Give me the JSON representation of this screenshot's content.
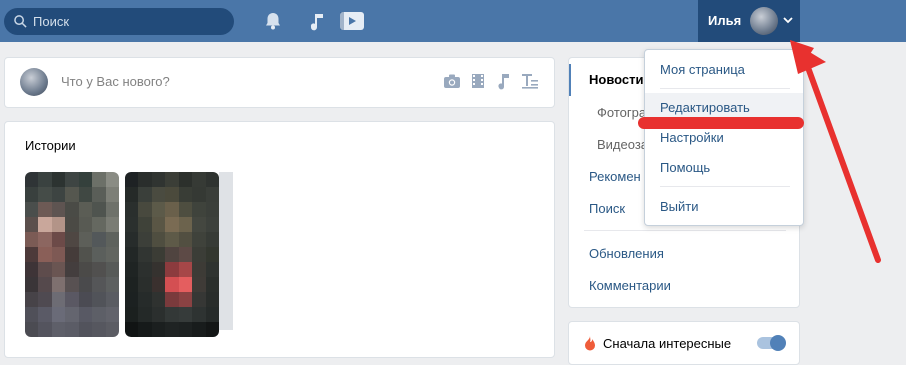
{
  "header": {
    "search_placeholder": "Поиск",
    "user_name": "Илья",
    "icons": [
      "search-icon",
      "bell-icon",
      "music-note-icon",
      "video-play-icon",
      "chevron-down-icon"
    ]
  },
  "post_box": {
    "placeholder": "Что у Вас нового?",
    "icons": [
      "camera-icon",
      "film-icon",
      "music-icon",
      "text-format-icon"
    ]
  },
  "stories": {
    "title": "Истории"
  },
  "right_menu": {
    "items": [
      {
        "label": "Новости",
        "active": true
      },
      {
        "label": "Фотогра",
        "sub": true
      },
      {
        "label": "Видеоза",
        "sub": true
      },
      {
        "label": "Рекомен"
      },
      {
        "label": "Поиск"
      },
      {
        "label": "Обновления"
      },
      {
        "label": "Комментарии"
      }
    ]
  },
  "sort": {
    "label": "Сначала интересные",
    "enabled": true
  },
  "dropdown": {
    "items": [
      {
        "label": "Моя страница"
      },
      {
        "label": "Редактировать",
        "highlighted": true
      },
      {
        "label": "Настройки"
      },
      {
        "label": "Помощь"
      },
      {
        "label": "Выйти"
      }
    ]
  },
  "colors": {
    "header_bg": "#4a76a8",
    "accent": "#5181b8",
    "link": "#2a5885",
    "annotation_red": "#e8312f"
  }
}
